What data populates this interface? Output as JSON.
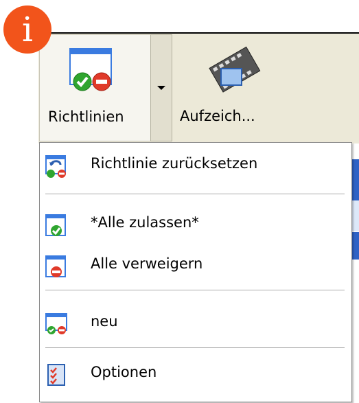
{
  "toolbar": {
    "rules_button_label": "Richtlinien",
    "record_button_label": "Aufzeich..."
  },
  "badge": {
    "glyph": "i",
    "color": "#f2541b"
  },
  "menu": {
    "items": [
      {
        "label": "Richtlinie zurücksetzen",
        "icon": "reset-policy-icon"
      },
      {
        "label": "*Alle zulassen*",
        "icon": "allow-all-icon"
      },
      {
        "label": "Alle verweigern",
        "icon": "deny-all-icon"
      },
      {
        "label": "neu",
        "icon": "new-policy-icon"
      },
      {
        "label": "Optionen",
        "icon": "options-checklist-icon"
      }
    ]
  },
  "colors": {
    "toolbar_bg": "#ece9d8",
    "allow_green": "#2fa52f",
    "deny_red": "#e03a2a",
    "window_blue": "#3a7be0"
  }
}
